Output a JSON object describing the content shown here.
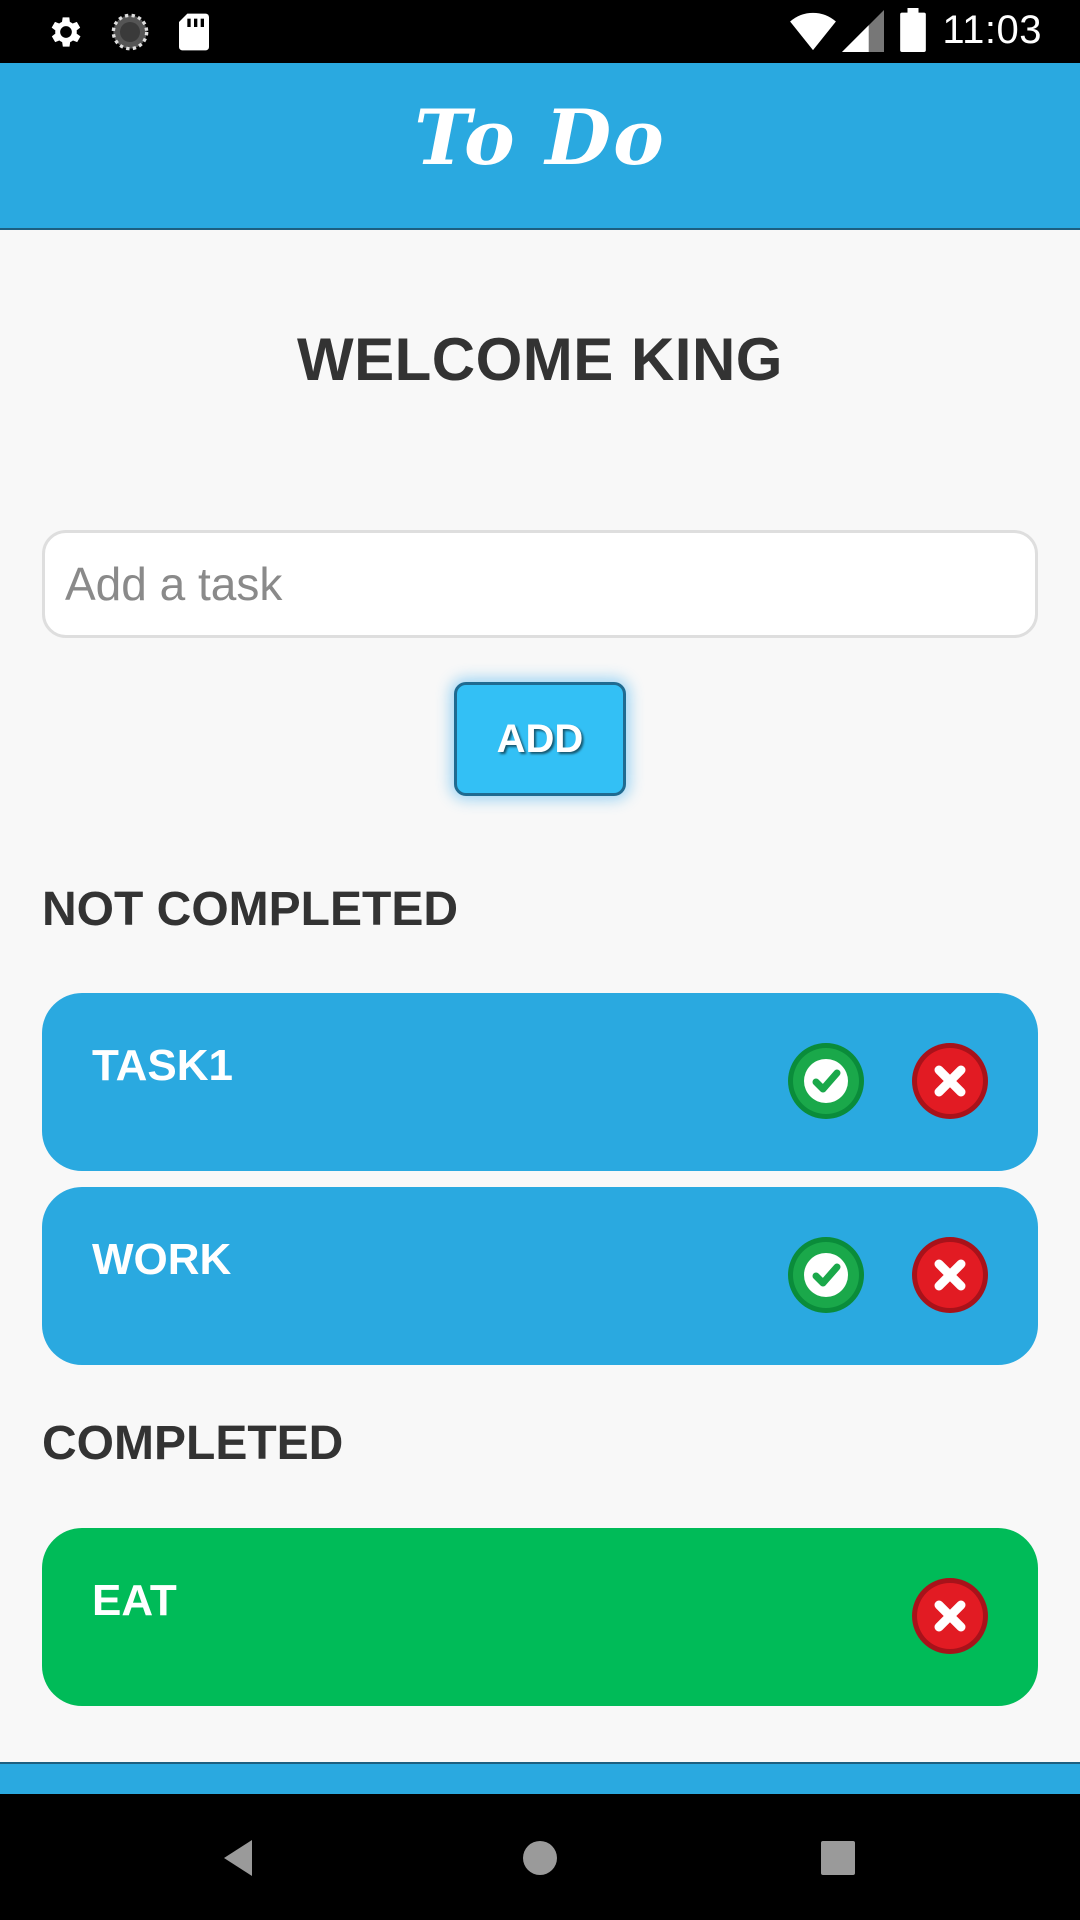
{
  "status_bar": {
    "time": "11:03",
    "left_icons": [
      "gear-icon",
      "sync-icon",
      "sd-card-icon"
    ],
    "right_icons": [
      "wifi-icon",
      "signal-icon",
      "battery-icon"
    ]
  },
  "header": {
    "title": "To Do",
    "background": "#2aa9e0"
  },
  "welcome_text": "WELCOME KING",
  "task_form": {
    "input_value": "",
    "input_placeholder": "Add a task",
    "add_button_label": "ADD"
  },
  "sections": {
    "not_completed_heading": "NOT COMPLETED",
    "completed_heading": "COMPLETED"
  },
  "not_completed_tasks": [
    {
      "label": "TASK1",
      "actions": [
        "check-icon",
        "close-icon"
      ]
    },
    {
      "label": "WORK",
      "actions": [
        "check-icon",
        "close-icon"
      ]
    }
  ],
  "completed_tasks": [
    {
      "label": "EAT",
      "actions": [
        "close-icon"
      ]
    }
  ],
  "colors": {
    "pending_card": "#2aa9e0",
    "completed_card": "#00bb58",
    "complete_button": "#1aa84a",
    "delete_button": "#e21b23"
  },
  "nav_bar": {
    "buttons": [
      "back-icon",
      "home-icon",
      "recents-icon"
    ]
  }
}
